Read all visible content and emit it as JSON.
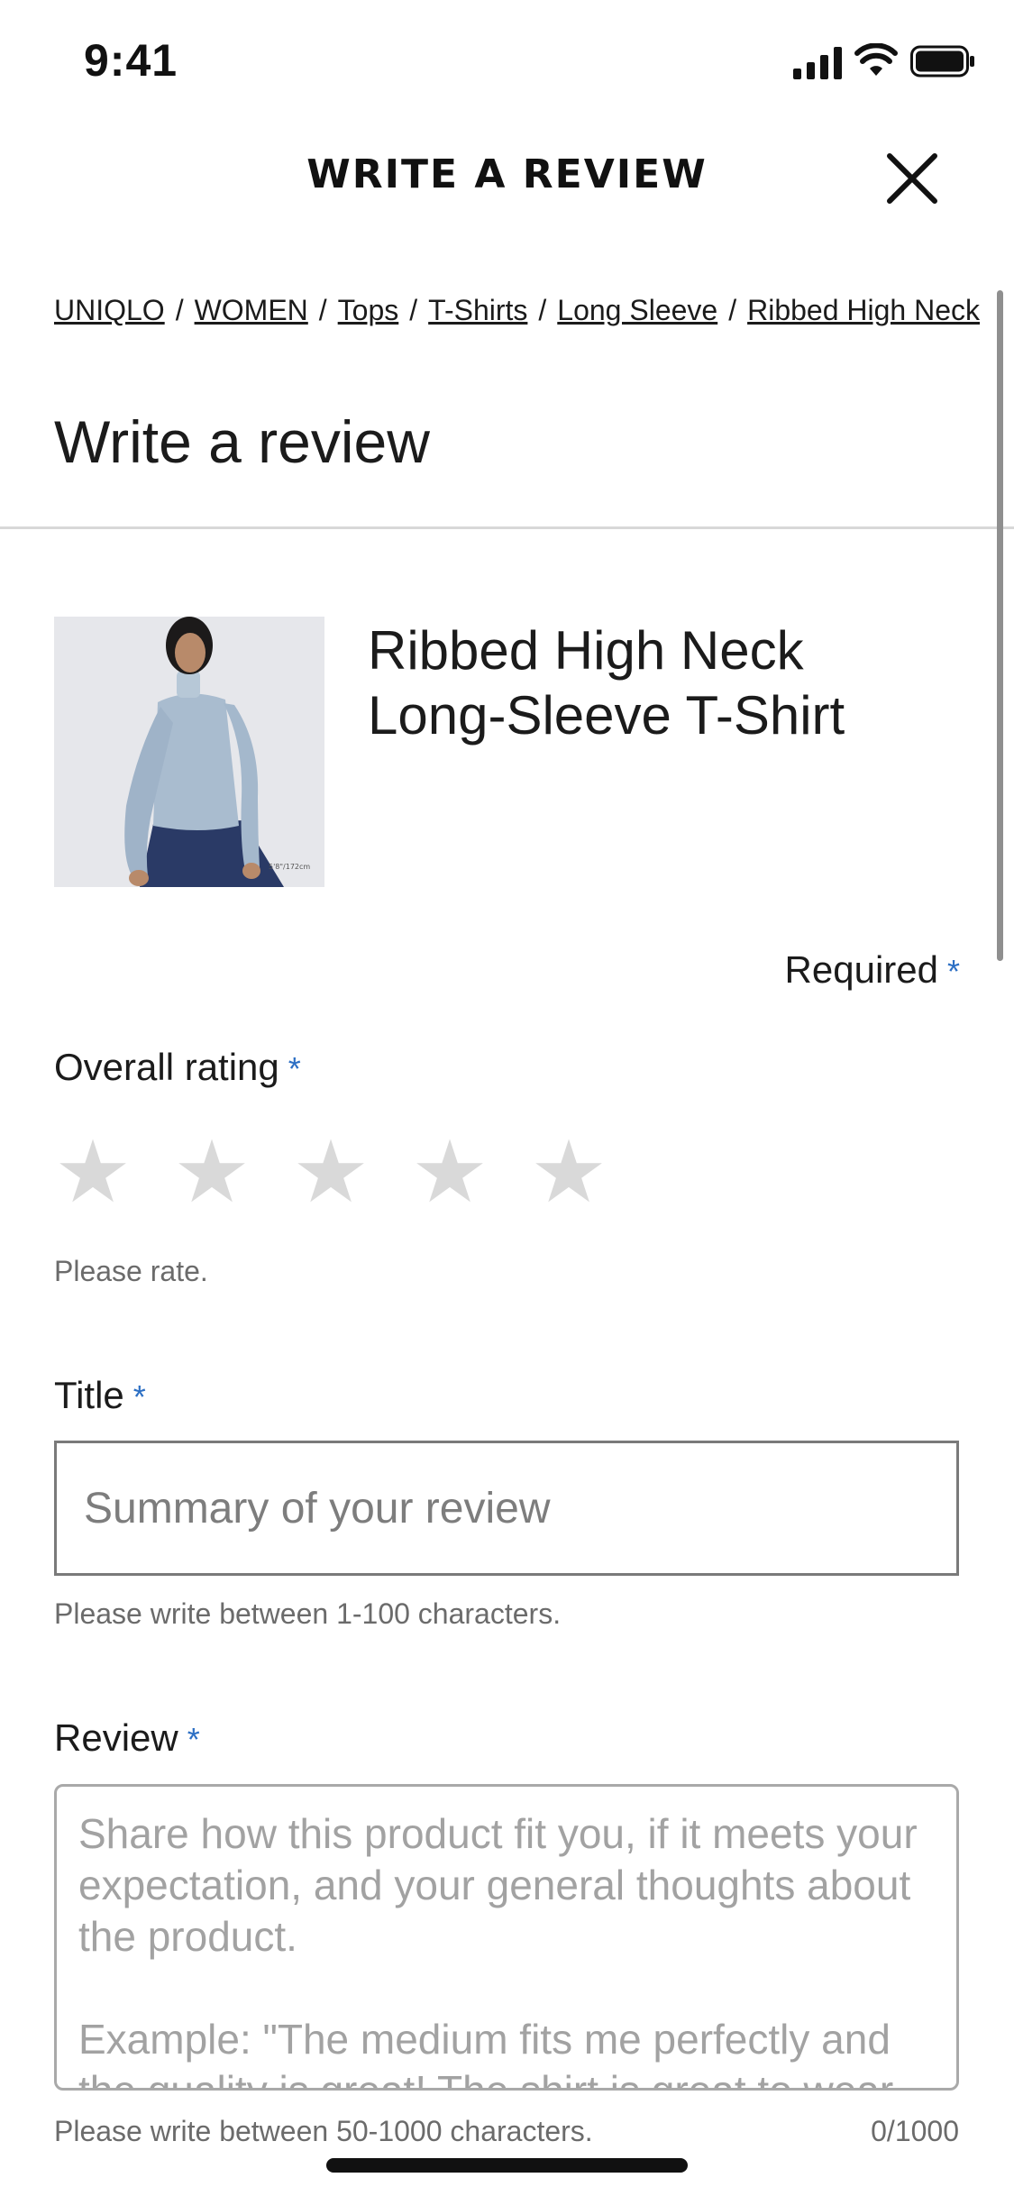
{
  "status_bar": {
    "time": "9:41"
  },
  "header": {
    "title": "WRITE A REVIEW"
  },
  "breadcrumb": {
    "items": [
      "UNIQLO",
      "WOMEN",
      "Tops",
      "T-Shirts",
      "Long Sleeve",
      "Ribbed High Neck"
    ],
    "separator": "/"
  },
  "page_title": "Write a review",
  "product": {
    "name": "Ribbed High Neck Long-Sleeve T-Shirt",
    "image_caption": "5'8\"/172cm"
  },
  "form": {
    "required_label": "Required",
    "asterisk": "*",
    "rating": {
      "label": "Overall rating",
      "stars": [
        "★",
        "★",
        "★",
        "★",
        "★"
      ],
      "helper": "Please rate."
    },
    "title": {
      "label": "Title",
      "placeholder": "Summary of your review",
      "value": "",
      "helper": "Please write between 1-100 characters."
    },
    "review": {
      "label": "Review",
      "placeholder": "Share how this product fit you, if it meets your expectation, and your general thoughts about the product.\n\nExample: \"The medium fits me perfectly and the quality is great! The shirt is great to wear",
      "helper": "Please write between 50-1000 characters.",
      "count": "0/1000"
    }
  },
  "colors": {
    "accent_asterisk": "#2c6fc4",
    "text": "#1b1b1b",
    "helper": "#6b6b6b",
    "star_empty": "#d9d9d9"
  }
}
